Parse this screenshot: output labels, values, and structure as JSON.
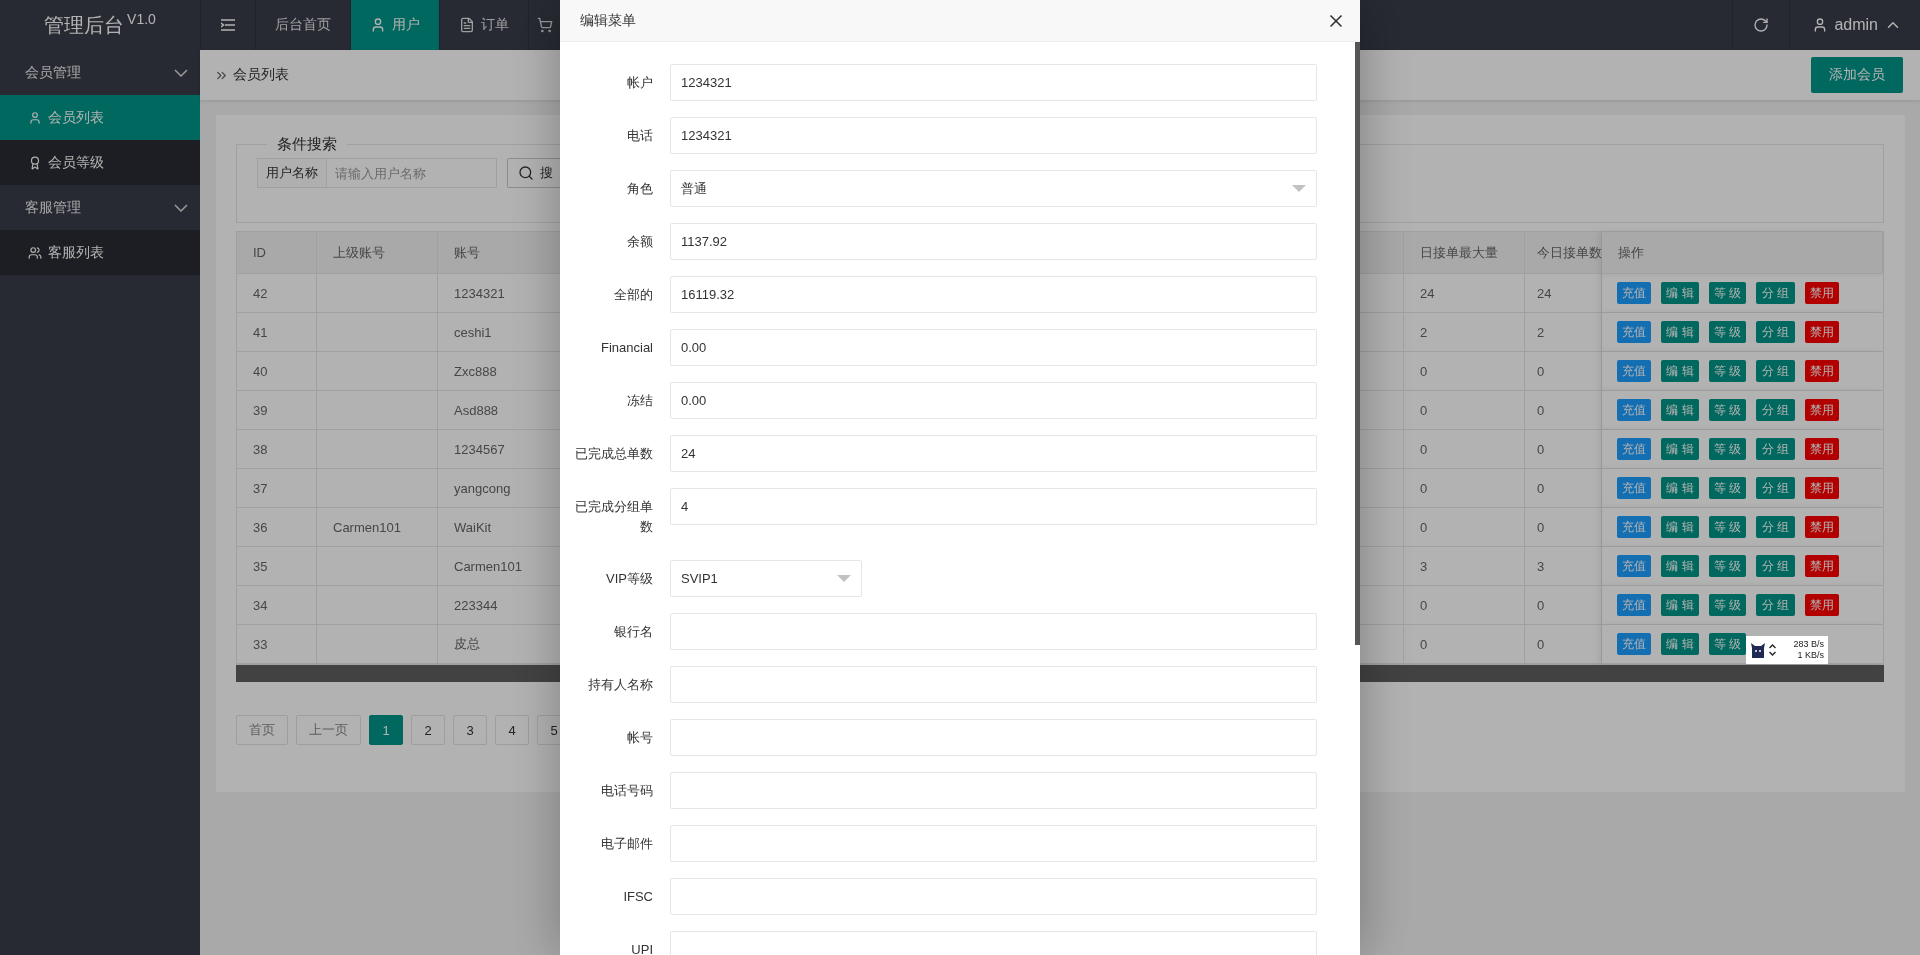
{
  "header": {
    "logo": "管理后台$^{V1.0}$",
    "nav": [
      {
        "label": "后台首页",
        "selected": false
      },
      {
        "label": "用户",
        "selected": true
      },
      {
        "label": "订单",
        "selected": false
      }
    ],
    "user": "admin"
  },
  "sidebar": {
    "groups": [
      {
        "label": "会员管理",
        "expanded": true,
        "children": [
          {
            "label": "会员列表",
            "selected": true
          },
          {
            "label": "会员等级",
            "selected": false
          }
        ]
      },
      {
        "label": "客服管理",
        "expanded": true,
        "children": [
          {
            "label": "客服列表",
            "selected": false
          }
        ]
      }
    ]
  },
  "breadcrumb": "会员列表",
  "add_button": "添加会员",
  "search": {
    "title": "条件搜索",
    "label": "用户名称",
    "placeholder": "请输入用户名称",
    "button": "搜"
  },
  "table": {
    "columns": [
      "ID",
      "上级账号",
      "账号",
      "日接单最大量",
      "今日接单数",
      "操作"
    ],
    "rows": [
      {
        "id": "42",
        "account": "1234321",
        "daily_max": "24",
        "today": "24",
        "actions": [
          {
            "label": "充值",
            "kind": "charge"
          },
          {
            "label": "编 辑",
            "kind": "edit"
          },
          {
            "label": "等 级",
            "kind": "level"
          },
          {
            "label": "分 组",
            "kind": "group"
          },
          {
            "label": "禁用",
            "kind": "disable"
          }
        ]
      },
      {
        "id": "41",
        "account": "ceshi1",
        "daily_max": "2",
        "today": "2",
        "actions": [
          {
            "label": "充值",
            "kind": "charge"
          },
          {
            "label": "编 辑",
            "kind": "edit"
          },
          {
            "label": "等 级",
            "kind": "level"
          },
          {
            "label": "分 组",
            "kind": "group"
          },
          {
            "label": "禁用",
            "kind": "disable"
          }
        ]
      },
      {
        "id": "40",
        "account": "Zxc888",
        "daily_max": "0",
        "today": "0",
        "actions": [
          {
            "label": "充值",
            "kind": "charge"
          },
          {
            "label": "编 辑",
            "kind": "edit"
          },
          {
            "label": "等 级",
            "kind": "level"
          },
          {
            "label": "分 组",
            "kind": "group"
          },
          {
            "label": "禁用",
            "kind": "disable"
          }
        ]
      },
      {
        "id": "39",
        "account": "Asd888",
        "daily_max": "0",
        "today": "0",
        "actions": [
          {
            "label": "充值",
            "kind": "charge"
          },
          {
            "label": "编 辑",
            "kind": "edit"
          },
          {
            "label": "等 级",
            "kind": "level"
          },
          {
            "label": "分 组",
            "kind": "group"
          },
          {
            "label": "禁用",
            "kind": "disable"
          }
        ]
      },
      {
        "id": "38",
        "account": "1234567",
        "daily_max": "0",
        "today": "0",
        "actions": [
          {
            "label": "充值",
            "kind": "charge"
          },
          {
            "label": "编 辑",
            "kind": "edit"
          },
          {
            "label": "等 级",
            "kind": "level"
          },
          {
            "label": "分 组",
            "kind": "group"
          },
          {
            "label": "禁用",
            "kind": "disable"
          }
        ]
      },
      {
        "id": "37",
        "account": "yangcong",
        "daily_max": "0",
        "today": "0",
        "actions": [
          {
            "label": "充值",
            "kind": "charge"
          },
          {
            "label": "编 辑",
            "kind": "edit"
          },
          {
            "label": "等 级",
            "kind": "level"
          },
          {
            "label": "分 组",
            "kind": "group"
          },
          {
            "label": "禁用",
            "kind": "disable"
          }
        ]
      },
      {
        "id": "36",
        "parent": "Carmen101",
        "account": "WaiKit",
        "daily_max": "0",
        "today": "0",
        "actions": [
          {
            "label": "充值",
            "kind": "charge"
          },
          {
            "label": "编 辑",
            "kind": "edit"
          },
          {
            "label": "等 级",
            "kind": "level"
          },
          {
            "label": "分 组",
            "kind": "group"
          },
          {
            "label": "禁用",
            "kind": "disable"
          }
        ]
      },
      {
        "id": "35",
        "account": "Carmen101",
        "daily_max": "3",
        "today": "3",
        "actions": [
          {
            "label": "充值",
            "kind": "charge"
          },
          {
            "label": "编 辑",
            "kind": "edit"
          },
          {
            "label": "等 级",
            "kind": "level"
          },
          {
            "label": "分 组",
            "kind": "group"
          },
          {
            "label": "禁用",
            "kind": "disable"
          }
        ]
      },
      {
        "id": "34",
        "account": "223344",
        "daily_max": "0",
        "today": "0",
        "actions": [
          {
            "label": "充值",
            "kind": "charge"
          },
          {
            "label": "编 辑",
            "kind": "edit"
          },
          {
            "label": "等 级",
            "kind": "level"
          },
          {
            "label": "分 组",
            "kind": "group"
          },
          {
            "label": "禁用",
            "kind": "disable"
          }
        ]
      },
      {
        "id": "33",
        "account": "皮总",
        "daily_max": "0",
        "today": "0",
        "actions": [
          {
            "label": "充值",
            "kind": "charge"
          },
          {
            "label": "编 辑",
            "kind": "edit"
          },
          {
            "label": "等 级",
            "kind": "level"
          }
        ]
      }
    ]
  },
  "pagination": [
    {
      "label": "首页",
      "selected": false,
      "disabled": true
    },
    {
      "label": "上一页",
      "selected": false,
      "disabled": true
    },
    {
      "label": "1",
      "selected": true,
      "disabled": false
    },
    {
      "label": "2",
      "selected": false,
      "disabled": false
    },
    {
      "label": "3",
      "selected": false,
      "disabled": false
    },
    {
      "label": "4",
      "selected": false,
      "disabled": false
    },
    {
      "label": "5",
      "selected": false,
      "disabled": false
    }
  ],
  "dialog": {
    "title": "编辑菜单",
    "fields": [
      {
        "label": "帐户",
        "value": "1234321",
        "kind": "text"
      },
      {
        "label": "电话",
        "value": "1234321",
        "kind": "text"
      },
      {
        "label": "角色",
        "value": "普通",
        "kind": "select"
      },
      {
        "label": "余额",
        "value": "1137.92",
        "kind": "text"
      },
      {
        "label": "全部的",
        "value": "16119.32",
        "kind": "text"
      },
      {
        "label": "Financial",
        "value": "0.00",
        "kind": "text"
      },
      {
        "label": "冻结",
        "value": "0.00",
        "kind": "text"
      },
      {
        "label": "已完成总单数",
        "value": "24",
        "kind": "text"
      },
      {
        "label": "已完成分组单数",
        "value": "4",
        "kind": "text"
      },
      {
        "label": "VIP等级",
        "value": "SVIP1",
        "kind": "short-select"
      },
      {
        "label": "银行名",
        "kind": "text"
      },
      {
        "label": "持有人名称",
        "kind": "text"
      },
      {
        "label": "帐号",
        "kind": "text"
      },
      {
        "label": "电话号码",
        "kind": "text"
      },
      {
        "label": "电子邮件",
        "kind": "text"
      },
      {
        "label": "IFSC",
        "kind": "text"
      },
      {
        "label": "UPI",
        "kind": "text"
      }
    ]
  },
  "network_widget": {
    "upload": "283 B/s",
    "download": "1 KB/s"
  }
}
